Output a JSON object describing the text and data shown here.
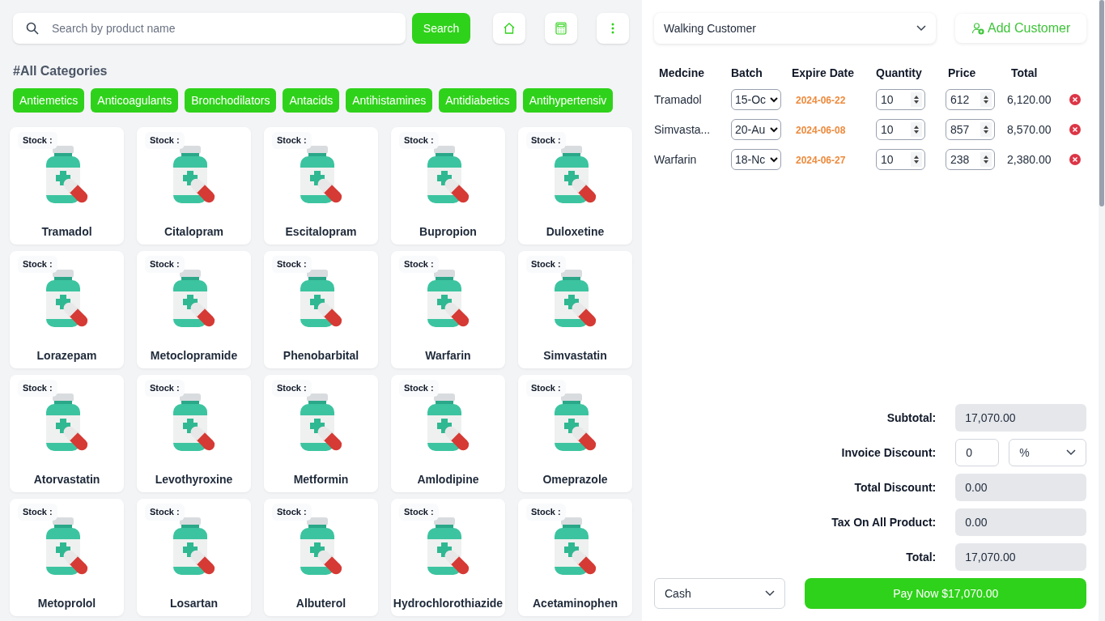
{
  "search": {
    "placeholder": "Search by product name",
    "button": "Search"
  },
  "categories_heading": "#All Categories",
  "categories": [
    "Antiemetics",
    "Anticoagulants",
    "Bronchodilators",
    "Antacids",
    "Antihistamines",
    "Antidiabetics",
    "Antihypertensiv"
  ],
  "products": [
    {
      "stock_label": "Stock :",
      "name": "Tramadol"
    },
    {
      "stock_label": "Stock :",
      "name": "Citalopram"
    },
    {
      "stock_label": "Stock :",
      "name": "Escitalopram"
    },
    {
      "stock_label": "Stock :",
      "name": "Bupropion"
    },
    {
      "stock_label": "Stock :",
      "name": "Duloxetine"
    },
    {
      "stock_label": "Stock :",
      "name": "Lorazepam"
    },
    {
      "stock_label": "Stock :",
      "name": "Metoclopramide"
    },
    {
      "stock_label": "Stock :",
      "name": "Phenobarbital"
    },
    {
      "stock_label": "Stock :",
      "name": "Warfarin"
    },
    {
      "stock_label": "Stock :",
      "name": "Simvastatin"
    },
    {
      "stock_label": "Stock :",
      "name": "Atorvastatin"
    },
    {
      "stock_label": "Stock :",
      "name": "Levothyroxine"
    },
    {
      "stock_label": "Stock :",
      "name": "Metformin"
    },
    {
      "stock_label": "Stock :",
      "name": "Amlodipine"
    },
    {
      "stock_label": "Stock :",
      "name": "Omeprazole"
    },
    {
      "stock_label": "Stock :",
      "name": "Metoprolol"
    },
    {
      "stock_label": "Stock :",
      "name": "Losartan"
    },
    {
      "stock_label": "Stock :",
      "name": "Albuterol"
    },
    {
      "stock_label": "Stock :",
      "name": "Hydrochlorothiazide"
    },
    {
      "stock_label": "Stock :",
      "name": "Acetaminophen"
    }
  ],
  "customer": {
    "value": "Walking Customer",
    "add_button": "Add Customer"
  },
  "cart": {
    "columns": [
      "Medcine",
      "Batch",
      "Expire Date",
      "Quantity",
      "Price",
      "Total"
    ],
    "rows": [
      {
        "medicine": "Tramadol",
        "batch": "15-Oc",
        "expire_date": "2024-06-22",
        "quantity": "10",
        "price": "612",
        "total": "6,120.00"
      },
      {
        "medicine": "Simvasta...",
        "batch": "20-Au",
        "expire_date": "2024-06-08",
        "quantity": "10",
        "price": "857",
        "total": "8,570.00"
      },
      {
        "medicine": "Warfarin",
        "batch": "18-Nc",
        "expire_date": "2024-06-27",
        "quantity": "10",
        "price": "238",
        "total": "2,380.00"
      }
    ]
  },
  "summary": [
    {
      "kind": "readonly",
      "label": "Subtotal:",
      "value": "17,070.00"
    },
    {
      "kind": "discount",
      "label": "Invoice Discount:",
      "value": "0",
      "unit": "%"
    },
    {
      "kind": "readonly",
      "label": "Total Discount:",
      "value": "0.00"
    },
    {
      "kind": "readonly",
      "label": "Tax On All Product:",
      "value": "0.00"
    },
    {
      "kind": "readonly",
      "label": "Total:",
      "value": "17,070.00"
    }
  ],
  "payment_method": "Cash",
  "pay_button": "Pay Now $17,070.00"
}
